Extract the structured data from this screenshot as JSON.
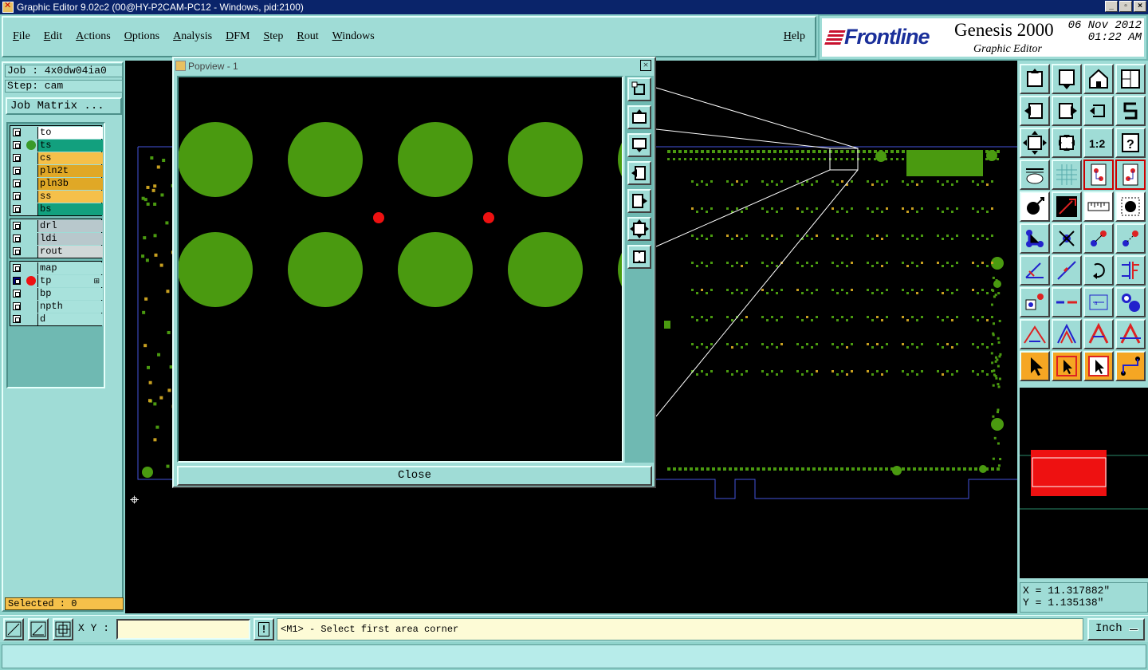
{
  "window": {
    "title": "Graphic Editor 9.02c2 (00@HY-P2CAM-PC12 - Windows, pid:2100)"
  },
  "menu": {
    "items": [
      "File",
      "Edit",
      "Actions",
      "Options",
      "Analysis",
      "DFM",
      "Step",
      "Rout",
      "Windows"
    ],
    "help": "Help"
  },
  "brand": {
    "logo": "Frontline",
    "product": "Genesis 2000",
    "subtitle": "Graphic Editor",
    "date": "06 Nov 2012",
    "time": "01:22 AM"
  },
  "job": {
    "label": "Job : 4x0dw04ia0",
    "step": "Step: cam",
    "matrix_button": "Job Matrix ..."
  },
  "layers": {
    "group1": [
      {
        "name": "to",
        "color": "#ffffff",
        "dot": ""
      },
      {
        "name": "ts",
        "color": "#12a07e",
        "dot": "#3a9a2a"
      },
      {
        "name": "cs",
        "color": "#f5c04a",
        "dot": ""
      },
      {
        "name": "pln2t",
        "color": "#e0a826",
        "dot": ""
      },
      {
        "name": "pln3b",
        "color": "#e0a826",
        "dot": ""
      },
      {
        "name": "ss",
        "color": "#f5c04a",
        "dot": ""
      },
      {
        "name": "bs",
        "color": "#12a07e",
        "dot": ""
      }
    ],
    "group2": [
      {
        "name": "drl",
        "color": "#b8c8cc",
        "dot": ""
      },
      {
        "name": "ldi",
        "color": "#b8c8cc",
        "dot": ""
      },
      {
        "name": "rout",
        "color": "#d0d8d8",
        "dot": ""
      }
    ],
    "group3": [
      {
        "name": "map",
        "color": "#a8e2dc",
        "dot": ""
      },
      {
        "name": "tp",
        "color": "#a8e2dc",
        "dot": "#ee1111",
        "mark": "⊞"
      },
      {
        "name": "bp",
        "color": "#a8e2dc",
        "dot": ""
      },
      {
        "name": "npth",
        "color": "#a8e2dc",
        "dot": ""
      },
      {
        "name": "d",
        "color": "#a8e2dc",
        "dot": ""
      }
    ]
  },
  "selected": "Selected : 0",
  "popview": {
    "title": "Popview - 1",
    "close_label": "Close"
  },
  "coords": {
    "x": "X = 11.317882\"",
    "y": "Y = 1.135138\""
  },
  "bottom": {
    "xy_label": "X Y :",
    "xy_value": "",
    "message": "<M1> - Select first area corner",
    "unit": "Inch"
  },
  "colors": {
    "pad_green": "#4a9a10",
    "pad_red": "#ee1111",
    "panel": "#9fdcd6"
  }
}
